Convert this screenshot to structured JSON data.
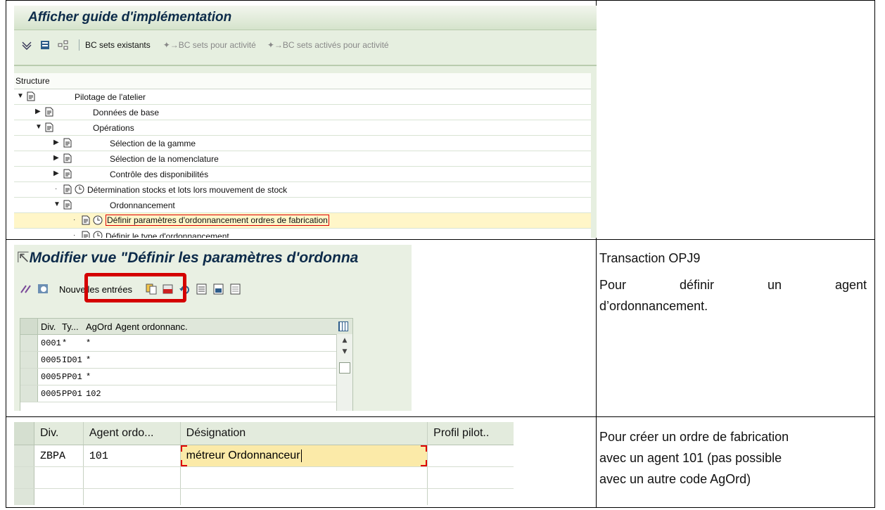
{
  "screen1": {
    "title": "Afficher guide d'implémentation",
    "toolbar": {
      "bc_sets_existants": "BC sets existants",
      "bc_sets_pour_activite": "BC sets pour activité",
      "bc_sets_actives": "BC sets activés pour activité"
    },
    "structure_label": "Structure",
    "tree": [
      {
        "label": "Pilotage de l'atelier"
      },
      {
        "label": "Données de base"
      },
      {
        "label": "Opérations"
      },
      {
        "label": "Sélection de la gamme"
      },
      {
        "label": "Sélection de la nomenclature"
      },
      {
        "label": "Contrôle des disponibilités"
      },
      {
        "label": "Détermination stocks et lots lors mouvement de stock"
      },
      {
        "label": "Ordonnancement"
      },
      {
        "label": "Définir paramètres d'ordonnancement ordres de fabrication"
      },
      {
        "label": "Définir le type d'ordonnancement"
      }
    ]
  },
  "screen2": {
    "title": "Modifier vue \"Définir les paramètres d'ordonna",
    "nouvelles_entrees": "Nouvelles entrées",
    "columns": [
      "Div.",
      "Ty...",
      "AgOrd",
      "Agent ordonnanc."
    ],
    "rows": [
      [
        "0001",
        "*",
        "*",
        ""
      ],
      [
        "0005",
        "ID01",
        "*",
        ""
      ],
      [
        "0005",
        "PP01",
        "*",
        ""
      ],
      [
        "0005",
        "PP01",
        "102",
        ""
      ]
    ]
  },
  "screen3": {
    "columns": [
      "Div.",
      "Agent ordo...",
      "Désignation",
      "Profil pilot.."
    ],
    "rows": [
      [
        "ZBPA",
        "101",
        "métreur Ordonnanceur",
        ""
      ]
    ]
  },
  "notes": {
    "note2_line1": "Transaction OPJ9",
    "note2_line2": "Pour définir un agent",
    "note2_line2a": "Pour",
    "note2_line2b": "définir",
    "note2_line2c": "un",
    "note2_line2d": "agent",
    "note2_line3": "d’ordonnancement.",
    "note3_line1": "Pour créer un ordre de fabrication",
    "note3_line2": "avec un agent 101 (pas possible",
    "note3_line3": "avec un autre code AgOrd)"
  },
  "colors": {
    "sap_green": "#e6efe0",
    "title_blue": "#0d2b4a",
    "highlight": "#fff6c8",
    "red": "#d40000"
  }
}
